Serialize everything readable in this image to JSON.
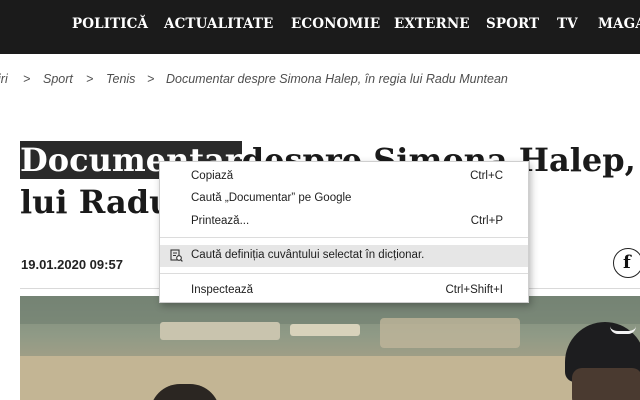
{
  "nav": {
    "items": [
      "POLITICĂ",
      "ACTUALITATE",
      "ECONOMIE",
      "EXTERNE",
      "SPORT",
      "TV",
      "MAGA"
    ]
  },
  "breadcrumb": {
    "items": [
      "iri",
      "Sport",
      "Tenis",
      "Documentar despre Simona Halep, în regia lui Radu Muntean"
    ],
    "separator": ">"
  },
  "article": {
    "title_selected": "Documentar",
    "title_rest_line1": "despre Simona Halep, î",
    "title_line2": "lui Radu",
    "date": "19.01.2020 09:57",
    "facebook_glyph": "f"
  },
  "context_menu": {
    "items": [
      {
        "label": "Copiază",
        "shortcut": "Ctrl+C"
      },
      {
        "label": "Caută „Documentar” pe Google",
        "shortcut": ""
      },
      {
        "label": "Printează...",
        "shortcut": "Ctrl+P"
      },
      {
        "label": "Caută definiția cuvântului selectat în dicționar.",
        "shortcut": "",
        "icon": "dictionary-icon",
        "highlighted": true
      },
      {
        "label": "Inspectează",
        "shortcut": "Ctrl+Shift+I"
      }
    ]
  },
  "colors": {
    "nav_background": "#1b1b1b",
    "selection": "#2a2a2a",
    "menu_highlight": "#e6e6e6"
  }
}
